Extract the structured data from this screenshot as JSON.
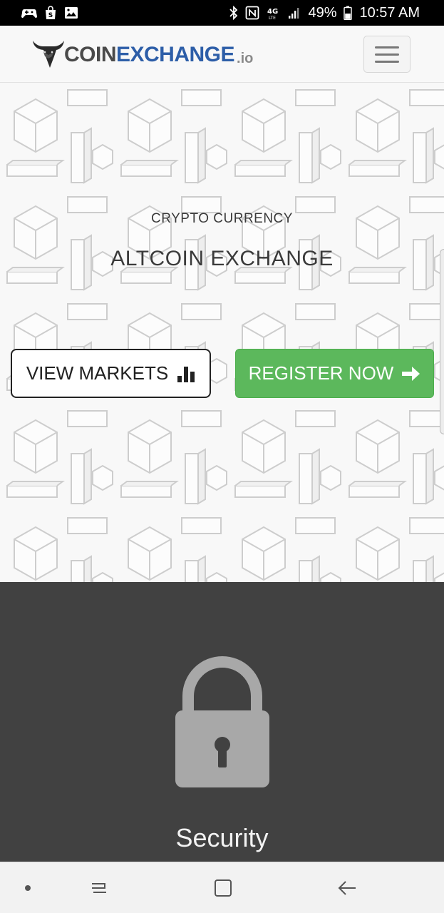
{
  "status_bar": {
    "battery_percent": "49%",
    "time": "10:57 AM",
    "left_icons": [
      "game-controller-icon",
      "shopping-bag-icon",
      "image-icon"
    ],
    "right_icons": [
      "bluetooth-icon",
      "nfc-icon",
      "4g-lte-icon",
      "signal-icon",
      "battery-icon"
    ]
  },
  "header": {
    "logo_part1": "COIN",
    "logo_part2": "EXCHANGE",
    "logo_suffix": ".io",
    "brand_color": "#2d5ea8"
  },
  "hero": {
    "subtitle": "CRYPTO CURRENCY",
    "title": "ALTCOIN EXCHANGE",
    "view_markets_label": "VIEW MARKETS",
    "register_label": "REGISTER NOW",
    "register_color": "#5cb85c"
  },
  "features": {
    "first_title": "Security",
    "section_bg": "#414141"
  },
  "android_nav": {
    "icons": [
      "dot-icon",
      "recents-icon",
      "home-icon",
      "back-icon"
    ]
  }
}
